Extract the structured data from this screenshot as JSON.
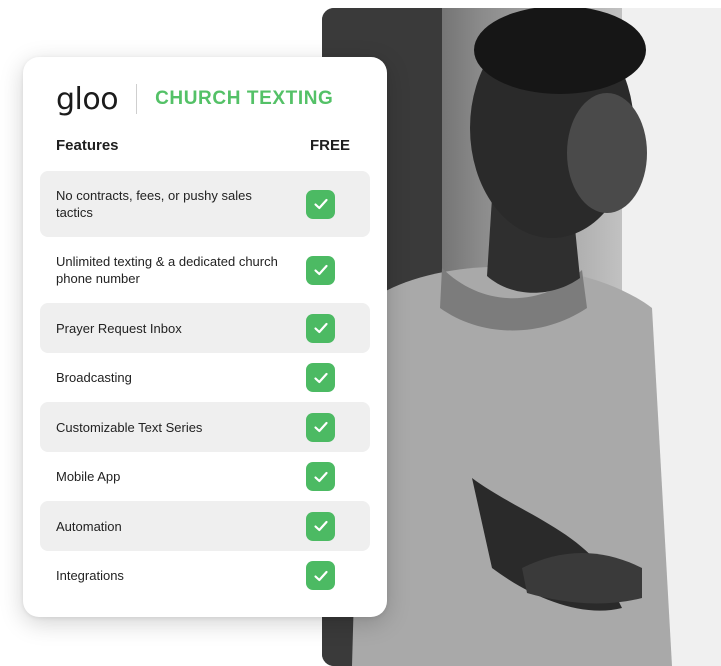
{
  "brand": {
    "logo": "gloo",
    "product": "CHURCH TEXTING",
    "accent_color": "#54c167"
  },
  "table": {
    "header_features": "Features",
    "header_plan": "FREE",
    "rows": [
      {
        "label": "No contracts, fees, or pushy sales tactics",
        "included": true
      },
      {
        "label": "Unlimited texting & a dedicated church phone number",
        "included": true
      },
      {
        "label": "Prayer Request Inbox",
        "included": true
      },
      {
        "label": "Broadcasting",
        "included": true
      },
      {
        "label": "Customizable Text Series",
        "included": true
      },
      {
        "label": "Mobile App",
        "included": true
      },
      {
        "label": "Automation",
        "included": true
      },
      {
        "label": "Integrations",
        "included": true
      }
    ],
    "check_icon": "checkmark-icon",
    "check_color": "#4cba63"
  }
}
